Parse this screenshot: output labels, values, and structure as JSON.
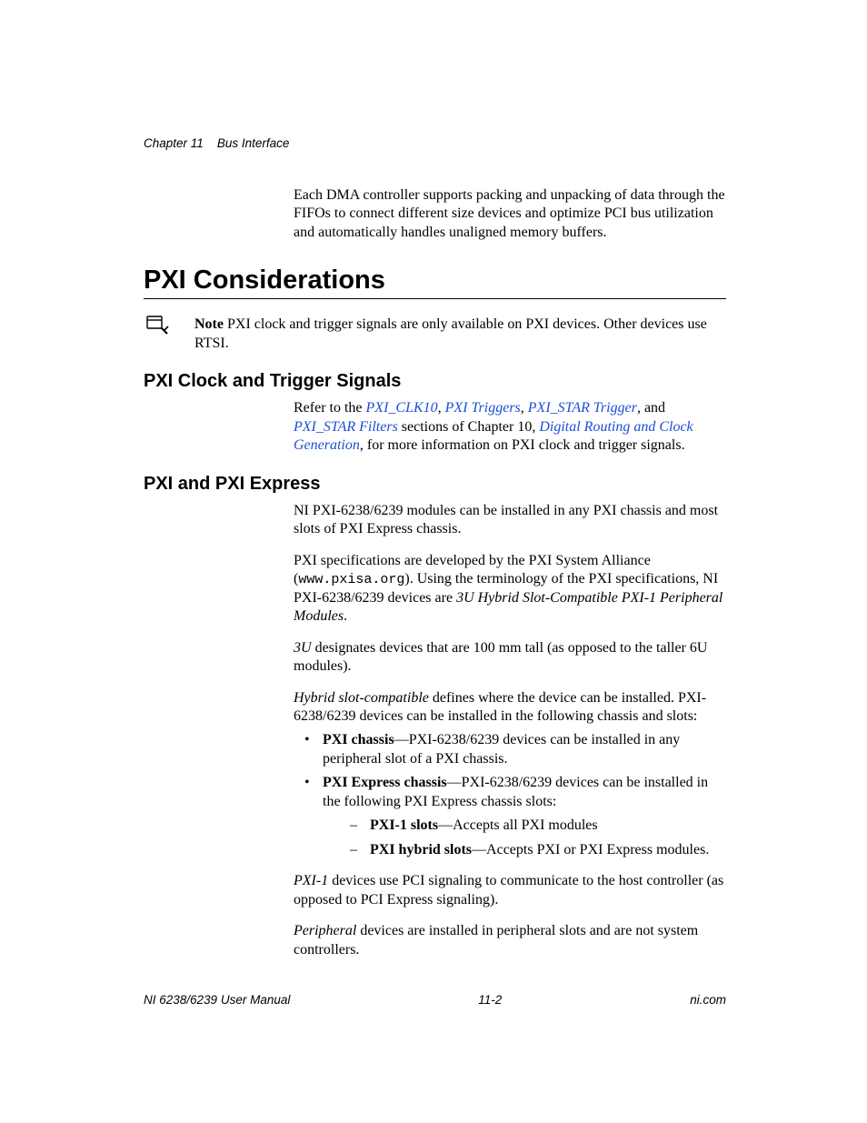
{
  "header": {
    "chapter_label": "Chapter 11",
    "chapter_title": "Bus Interface"
  },
  "intro_paragraph": "Each DMA controller supports packing and unpacking of data through the FIFOs to connect different size devices and optimize PCI bus utilization and automatically handles unaligned memory buffers.",
  "h1": "PXI Considerations",
  "note": {
    "label": "Note",
    "text": " PXI clock and trigger signals are only available on PXI devices. Other devices use RTSI."
  },
  "section_clock": {
    "heading": "PXI Clock and Trigger Signals",
    "lead": "Refer to the ",
    "links": {
      "clk10": "PXI_CLK10",
      "triggers": "PXI Triggers",
      "star_trigger": "PXI_STAR Trigger",
      "star_filters": "PXI_STAR Filters",
      "routing": "Digital Routing and Clock Generation"
    },
    "mid1": ", ",
    "mid2": ", ",
    "mid3": ", and ",
    "mid4": " sections of Chapter 10, ",
    "tail": ", for more information on PXI clock and trigger signals."
  },
  "section_express": {
    "heading": "PXI and PXI Express",
    "p1": "NI PXI-6238/6239 modules can be installed in any PXI chassis and most slots of PXI Express chassis.",
    "p2_a": "PXI specifications are developed by the PXI System Alliance (",
    "p2_url": "www.pxisa.org",
    "p2_b": "). Using the terminology of the PXI specifications, NI PXI-6238/6239 devices are ",
    "p2_term": "3U Hybrid Slot-Compatible PXI-1 Peripheral Modules",
    "p2_c": ".",
    "p3_em": "3U",
    "p3_rest": " designates devices that are 100 mm tall (as opposed to the taller 6U modules).",
    "p4_em": "Hybrid slot-compatible",
    "p4_rest": " defines where the device can be installed. PXI-6238/6239 devices can be installed in the following chassis and slots:",
    "bullets": {
      "b1_label": "PXI chassis",
      "b1_text": "—PXI-6238/6239 devices can be installed in any peripheral slot of a PXI chassis.",
      "b2_label": "PXI Express chassis",
      "b2_text": "—PXI-6238/6239 devices can be installed in the following PXI Express chassis slots:",
      "sub1_label": "PXI-1 slots",
      "sub1_text": "—Accepts all PXI modules",
      "sub2_label": "PXI hybrid slots",
      "sub2_text": "—Accepts PXI or PXI Express modules."
    },
    "p5_em": "PXI-1",
    "p5_rest": " devices use PCI signaling to communicate to the host controller (as opposed to PCI Express signaling).",
    "p6_em": "Peripheral",
    "p6_rest": " devices are installed in peripheral slots and are not system controllers."
  },
  "footer": {
    "left": "NI 6238/6239 User Manual",
    "center": "11-2",
    "right": "ni.com"
  }
}
